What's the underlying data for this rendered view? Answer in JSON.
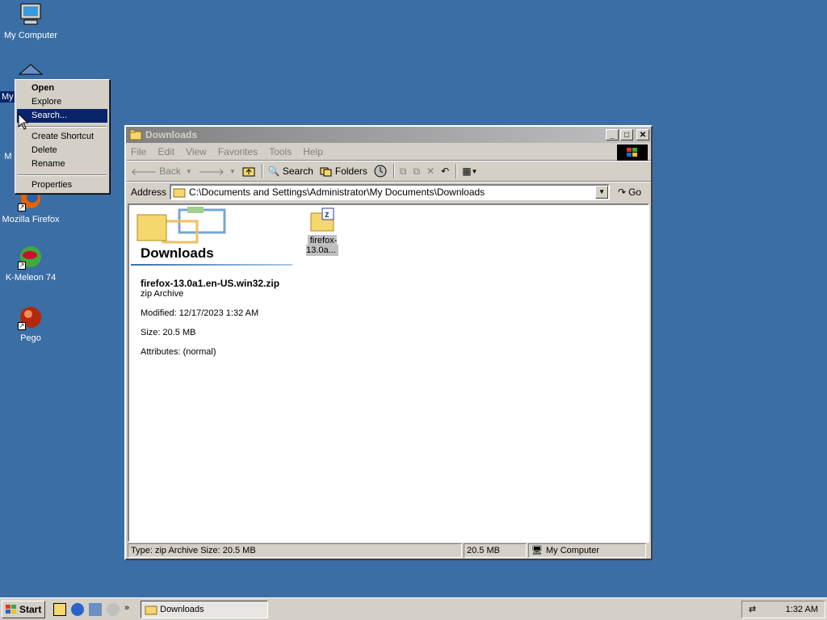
{
  "desktop": {
    "icons": [
      {
        "label": "My Computer"
      },
      {
        "label": "My"
      },
      {
        "label": "M"
      },
      {
        "label": "Mozilla Firefox"
      },
      {
        "label": "K-Meleon 74"
      },
      {
        "label": "Pego"
      }
    ]
  },
  "context_menu": {
    "items": [
      "Open",
      "Explore",
      "Search...",
      "Create Shortcut",
      "Delete",
      "Rename",
      "Properties"
    ],
    "highlighted": "Search..."
  },
  "window": {
    "title": "Downloads",
    "menu": [
      "File",
      "Edit",
      "View",
      "Favorites",
      "Tools",
      "Help"
    ],
    "toolbar": {
      "back": "Back",
      "search": "Search",
      "folders": "Folders"
    },
    "address_label": "Address",
    "address_value": "C:\\Documents and Settings\\Administrator\\My Documents\\Downloads",
    "go_label": "Go",
    "folder_title": "Downloads",
    "selected_file": {
      "name": "firefox-13.0a1.en-US.win32.zip",
      "type": "zip Archive",
      "modified": "Modified: 12/17/2023 1:32 AM",
      "size": "Size: 20.5 MB",
      "attributes": "Attributes: (normal)"
    },
    "file_icon_label": "firefox-13.0a...",
    "status": {
      "main": "Type: zip Archive Size: 20.5 MB",
      "size": "20.5 MB",
      "zone": "My Computer"
    }
  },
  "taskbar": {
    "start": "Start",
    "task": "Downloads",
    "clock": "1:32 AM"
  }
}
